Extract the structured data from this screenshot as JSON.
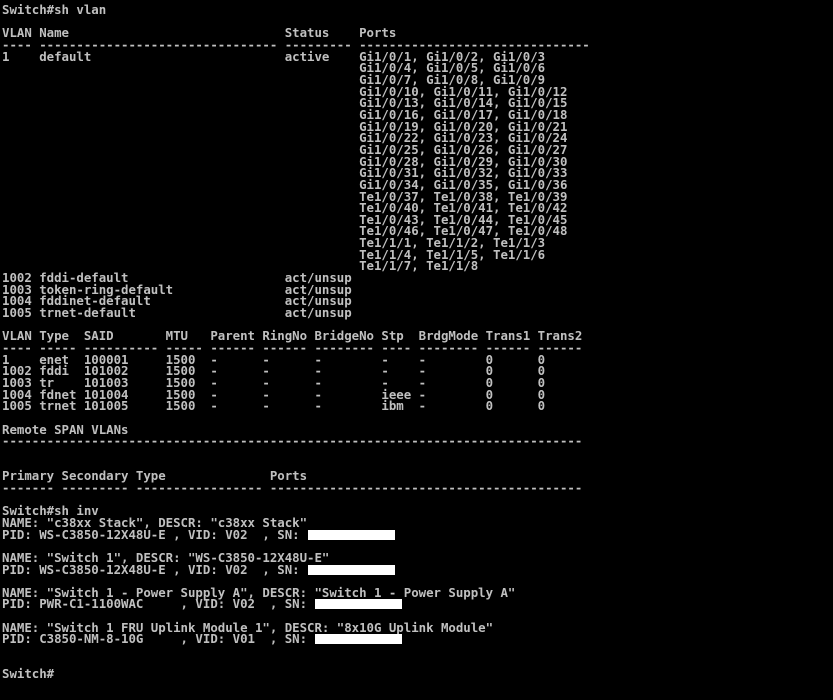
{
  "terminal": {
    "colors": {
      "background": "#000000",
      "foreground": "#c0c0c0",
      "redaction": "#ffffff"
    },
    "lines": [
      {
        "text": "Switch#sh vlan"
      },
      {
        "text": ""
      },
      {
        "text": "VLAN Name                             Status    Ports"
      },
      {
        "text": "---- -------------------------------- --------- -------------------------------"
      },
      {
        "text": "1    default                          active    Gi1/0/1, Gi1/0/2, Gi1/0/3"
      },
      {
        "text": "                                                Gi1/0/4, Gi1/0/5, Gi1/0/6"
      },
      {
        "text": "                                                Gi1/0/7, Gi1/0/8, Gi1/0/9"
      },
      {
        "text": "                                                Gi1/0/10, Gi1/0/11, Gi1/0/12"
      },
      {
        "text": "                                                Gi1/0/13, Gi1/0/14, Gi1/0/15"
      },
      {
        "text": "                                                Gi1/0/16, Gi1/0/17, Gi1/0/18"
      },
      {
        "text": "                                                Gi1/0/19, Gi1/0/20, Gi1/0/21"
      },
      {
        "text": "                                                Gi1/0/22, Gi1/0/23, Gi1/0/24"
      },
      {
        "text": "                                                Gi1/0/25, Gi1/0/26, Gi1/0/27"
      },
      {
        "text": "                                                Gi1/0/28, Gi1/0/29, Gi1/0/30"
      },
      {
        "text": "                                                Gi1/0/31, Gi1/0/32, Gi1/0/33"
      },
      {
        "text": "                                                Gi1/0/34, Gi1/0/35, Gi1/0/36"
      },
      {
        "text": "                                                Te1/0/37, Te1/0/38, Te1/0/39"
      },
      {
        "text": "                                                Te1/0/40, Te1/0/41, Te1/0/42"
      },
      {
        "text": "                                                Te1/0/43, Te1/0/44, Te1/0/45"
      },
      {
        "text": "                                                Te1/0/46, Te1/0/47, Te1/0/48"
      },
      {
        "text": "                                                Te1/1/1, Te1/1/2, Te1/1/3"
      },
      {
        "text": "                                                Te1/1/4, Te1/1/5, Te1/1/6"
      },
      {
        "text": "                                                Te1/1/7, Te1/1/8"
      },
      {
        "text": "1002 fddi-default                     act/unsup"
      },
      {
        "text": "1003 token-ring-default               act/unsup"
      },
      {
        "text": "1004 fddinet-default                  act/unsup"
      },
      {
        "text": "1005 trnet-default                    act/unsup"
      },
      {
        "text": ""
      },
      {
        "text": "VLAN Type  SAID       MTU   Parent RingNo BridgeNo Stp  BrdgMode Trans1 Trans2"
      },
      {
        "text": "---- ----- ---------- ----- ------ ------ -------- ---- -------- ------ ------"
      },
      {
        "text": "1    enet  100001     1500  -      -      -        -    -        0      0"
      },
      {
        "text": "1002 fddi  101002     1500  -      -      -        -    -        0      0"
      },
      {
        "text": "1003 tr    101003     1500  -      -      -        -    -        0      0"
      },
      {
        "text": "1004 fdnet 101004     1500  -      -      -        ieee -        0      0"
      },
      {
        "text": "1005 trnet 101005     1500  -      -      -        ibm  -        0      0"
      },
      {
        "text": ""
      },
      {
        "text": "Remote SPAN VLANs"
      },
      {
        "text": "------------------------------------------------------------------------------"
      },
      {
        "text": ""
      },
      {
        "text": ""
      },
      {
        "text": "Primary Secondary Type              Ports"
      },
      {
        "text": "------- --------- ----------------- ------------------------------------------"
      },
      {
        "text": ""
      },
      {
        "text": "Switch#sh inv"
      },
      {
        "text": "NAME: \"c38xx Stack\", DESCR: \"c38xx Stack\""
      },
      {
        "text": "PID: WS-C3850-12X48U-E , VID: V02  , SN: ",
        "redacted": true
      },
      {
        "text": ""
      },
      {
        "text": "NAME: \"Switch 1\", DESCR: \"WS-C3850-12X48U-E\""
      },
      {
        "text": "PID: WS-C3850-12X48U-E , VID: V02  , SN: ",
        "redacted": true
      },
      {
        "text": ""
      },
      {
        "text": "NAME: \"Switch 1 - Power Supply A\", DESCR: \"Switch 1 - Power Supply A\""
      },
      {
        "text": "PID: PWR-C1-1100WAC     , VID: V02  , SN: ",
        "redacted": true
      },
      {
        "text": ""
      },
      {
        "text": "NAME: \"Switch 1 FRU Uplink Module 1\", DESCR: \"8x10G Uplink Module\""
      },
      {
        "text": "PID: C3850-NM-8-10G     , VID: V01  , SN: ",
        "redacted": true
      },
      {
        "text": ""
      },
      {
        "text": ""
      },
      {
        "text": "Switch#"
      }
    ]
  }
}
